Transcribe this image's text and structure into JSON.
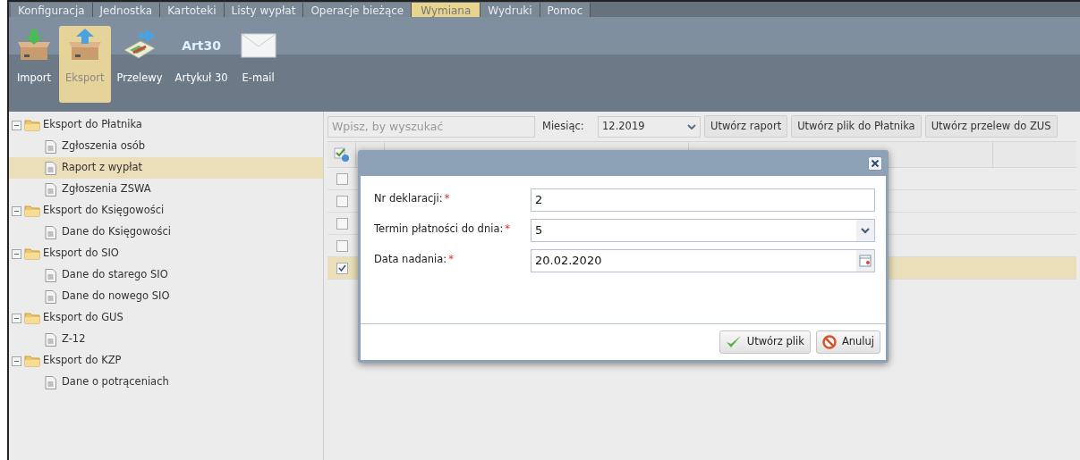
{
  "menu": [
    {
      "label": "Konfiguracja",
      "selected": false
    },
    {
      "label": "Jednostka",
      "selected": false
    },
    {
      "label": "Kartoteki",
      "selected": false
    },
    {
      "label": "Listy wypłat",
      "selected": false
    },
    {
      "label": "Operacje bieżące",
      "selected": false
    },
    {
      "label": "Wymiana",
      "selected": true
    },
    {
      "label": "Wydruki",
      "selected": false
    },
    {
      "label": "Pomoc",
      "selected": false
    }
  ],
  "toolbar": [
    {
      "kind": "import",
      "label": "Import",
      "selected": false
    },
    {
      "kind": "export",
      "label": "Eksport",
      "selected": true
    },
    {
      "kind": "transfer",
      "label": "Przelewy",
      "selected": false
    },
    {
      "kind": "art",
      "label": "Artykuł 30",
      "icon_text": "Art30",
      "selected": false
    },
    {
      "kind": "mail",
      "label": "E-mail",
      "selected": false
    }
  ],
  "tree": [
    {
      "label": "Eksport do Płatnika",
      "expanded": true,
      "children": [
        {
          "label": "Zgłoszenia osób",
          "selected": false
        },
        {
          "label": "Raport z wypłat",
          "selected": true
        },
        {
          "label": "Zgłoszenia ZSWA",
          "selected": false
        }
      ]
    },
    {
      "label": "Eksport do Księgowości",
      "expanded": true,
      "children": [
        {
          "label": "Dane do Księgowości",
          "selected": false
        }
      ]
    },
    {
      "label": "Eksport do SIO",
      "expanded": true,
      "children": [
        {
          "label": "Dane do starego SIO",
          "selected": false
        },
        {
          "label": "Dane do nowego SIO",
          "selected": false
        }
      ]
    },
    {
      "label": "Eksport do GUS",
      "expanded": true,
      "children": [
        {
          "label": "Z-12",
          "selected": false
        }
      ]
    },
    {
      "label": "Eksport do KZP",
      "expanded": true,
      "children": [
        {
          "label": "Dane o potrąceniach",
          "selected": false
        }
      ]
    }
  ],
  "filter": {
    "search_placeholder": "Wpisz, by wyszukać",
    "month_label": "Miesiąc:",
    "month_value": "12.2019",
    "buttons": [
      "Utwórz raport",
      "Utwórz plik do Płatnika",
      "Utwórz przelew do ZUS"
    ]
  },
  "grid": {
    "rows": [
      {
        "checked": false
      },
      {
        "checked": false
      },
      {
        "checked": false
      },
      {
        "checked": false
      },
      {
        "checked": true
      }
    ]
  },
  "dialog": {
    "fields": [
      {
        "kind": "text",
        "label": "Nr deklaracji:",
        "required_mark": "*",
        "value": "2"
      },
      {
        "kind": "select",
        "label": "Termin płatności do dnia:",
        "required_mark": "*",
        "value": "5"
      },
      {
        "kind": "date",
        "label": "Data nadania:",
        "required_mark": "*",
        "value": "20.02.2020"
      }
    ],
    "buttons": [
      {
        "kind": "ok",
        "label": "Utwórz plik"
      },
      {
        "kind": "cancel",
        "label": "Anuluj"
      }
    ]
  }
}
